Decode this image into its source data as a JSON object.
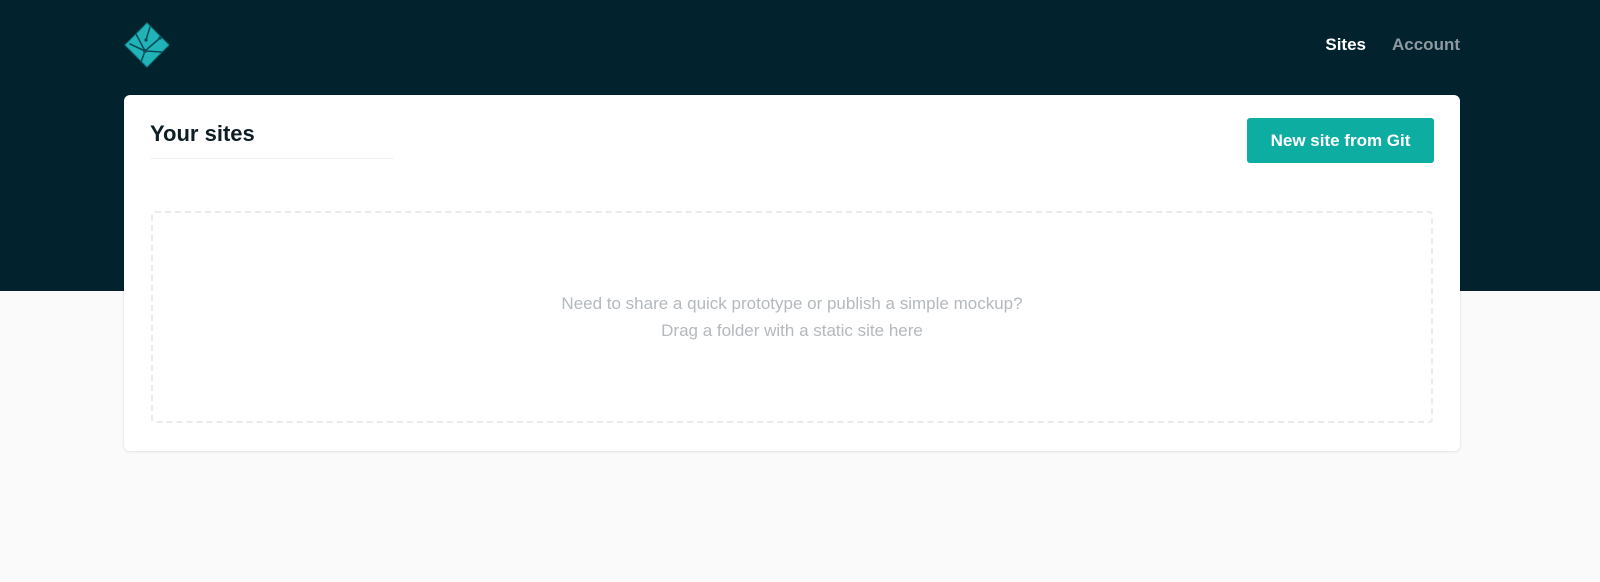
{
  "header": {
    "logo_icon": "netlify-logo-icon",
    "nav": {
      "sites_label": "Sites",
      "account_label": "Account"
    }
  },
  "main": {
    "title": "Your sites",
    "new_site_button_label": "New site from Git",
    "dropzone": {
      "line1": "Need to share a quick prototype or publish a simple mockup?",
      "line2": "Drag a folder with a static site here"
    }
  },
  "colors": {
    "header_bg": "#02222e",
    "accent": "#0eada1",
    "page_bg": "#fafafa"
  }
}
